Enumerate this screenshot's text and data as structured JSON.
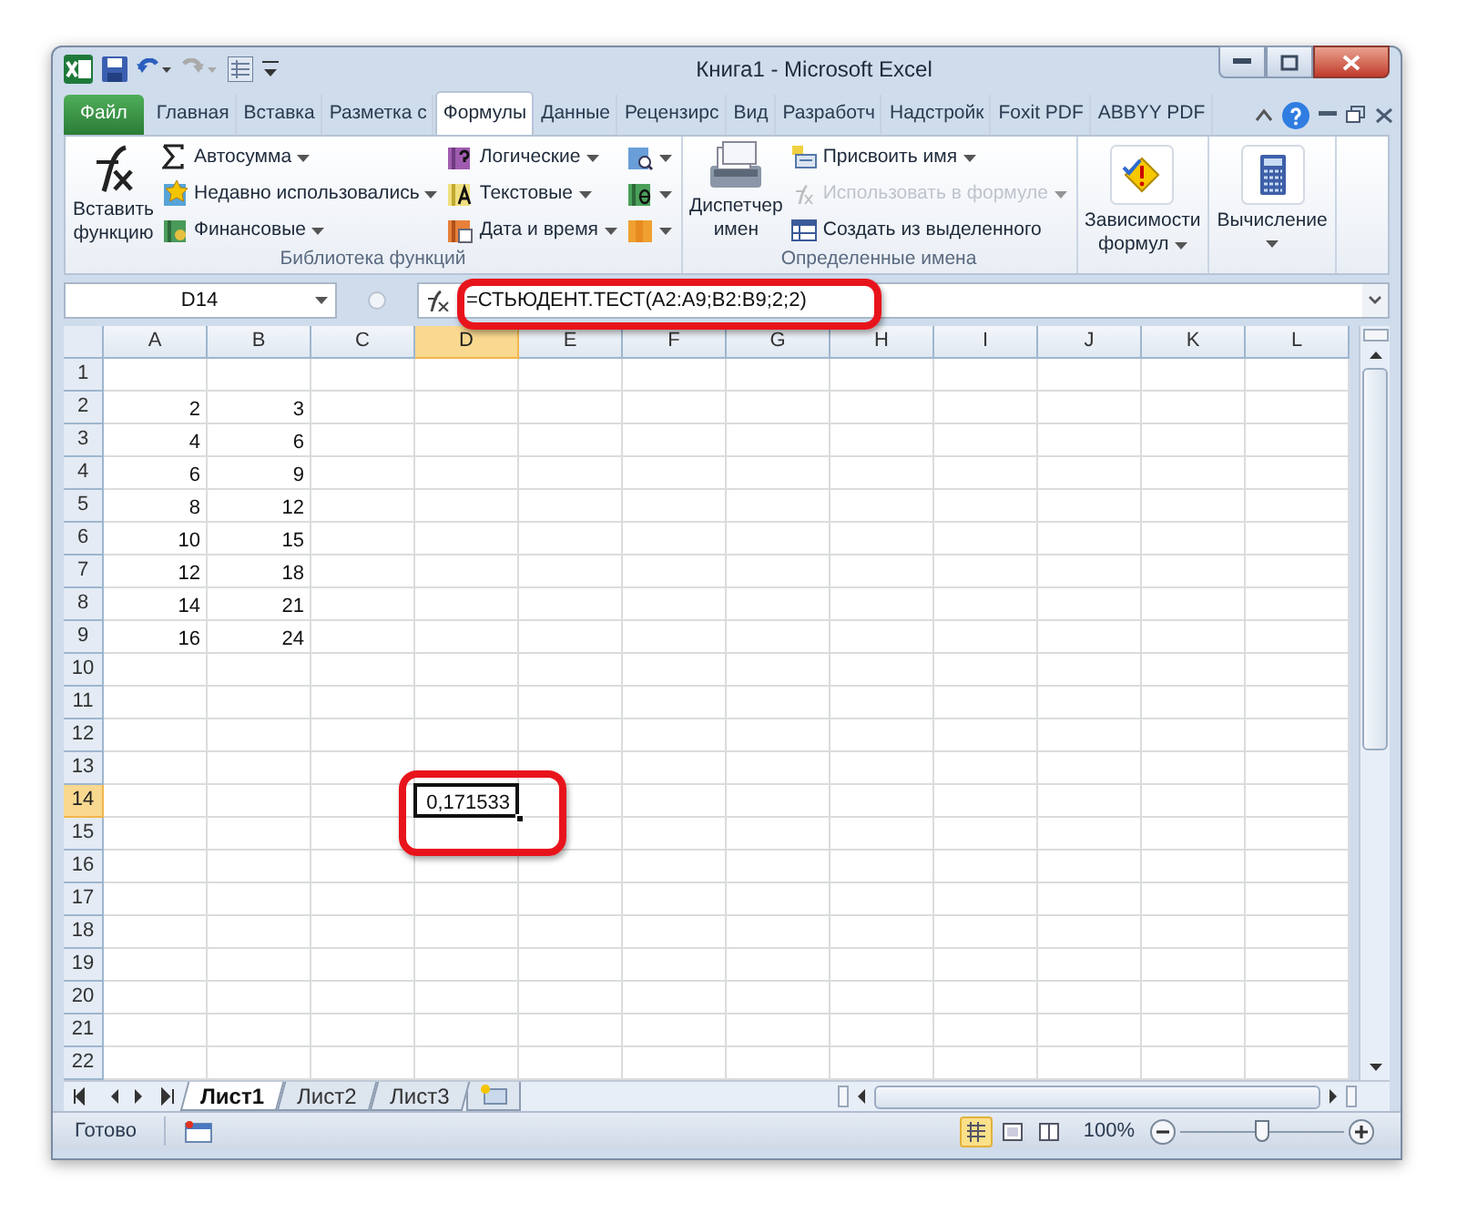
{
  "window": {
    "title": "Книга1 - Microsoft Excel"
  },
  "ribbon_tabs": [
    {
      "label": "Файл",
      "kind": "file",
      "selected": false
    },
    {
      "label": "Главная",
      "kind": "tab",
      "selected": false
    },
    {
      "label": "Вставка",
      "kind": "tab",
      "selected": false
    },
    {
      "label": "Разметка с",
      "kind": "tab",
      "selected": false
    },
    {
      "label": "Формулы",
      "kind": "tab",
      "selected": true
    },
    {
      "label": "Данные",
      "kind": "tab",
      "selected": false
    },
    {
      "label": "Рецензирс",
      "kind": "tab",
      "selected": false
    },
    {
      "label": "Вид",
      "kind": "tab",
      "selected": false
    },
    {
      "label": "Разработч",
      "kind": "tab",
      "selected": false
    },
    {
      "label": "Надстройк",
      "kind": "tab",
      "selected": false
    },
    {
      "label": "Foxit PDF",
      "kind": "tab",
      "selected": false
    },
    {
      "label": "ABBYY PDF",
      "kind": "tab",
      "selected": false
    }
  ],
  "ribbon_groups": [
    {
      "title": "Библиотека функций",
      "big_button": {
        "lines": [
          "Вставить",
          "функцию"
        ],
        "dropdown": false
      },
      "columns": [
        [
          {
            "label": "Автосумма",
            "dropdown": true,
            "disabled": false
          },
          {
            "label": "Недавно использовались",
            "dropdown": true,
            "disabled": false
          },
          {
            "label": "Финансовые",
            "dropdown": true,
            "disabled": false
          }
        ],
        [
          {
            "label": "Логические",
            "dropdown": true,
            "disabled": false
          },
          {
            "label": "Текстовые",
            "dropdown": true,
            "disabled": false
          },
          {
            "label": "Дата и время",
            "dropdown": true,
            "disabled": false
          }
        ],
        [
          {
            "dropdown": true,
            "disabled": false
          },
          {
            "dropdown": true,
            "disabled": false
          },
          {
            "dropdown": true,
            "disabled": false
          }
        ]
      ]
    },
    {
      "title": "Определенные имена",
      "big_button": {
        "lines": [
          "Диспетчер",
          "имен"
        ],
        "dropdown": false
      },
      "columns": [
        [
          {
            "label": "Присвоить имя",
            "dropdown": true,
            "disabled": false
          },
          {
            "label": "Использовать в формуле",
            "dropdown": true,
            "disabled": true
          },
          {
            "label": "Создать из выделенного",
            "dropdown": false,
            "disabled": false
          }
        ]
      ]
    },
    {
      "big_button": {
        "lines": [
          "Зависимости",
          "формул"
        ],
        "dropdown": true
      }
    },
    {
      "big_button": {
        "lines": [
          "Вычисление"
        ],
        "dropdown": true
      }
    }
  ],
  "formula_bar": {
    "name_box": "D14",
    "formula": "=СТЬЮДЕНТ.ТЕСТ(A2:A9;B2:B9;2;2)",
    "annotated": true
  },
  "sheet": {
    "columns": [
      {
        "label": "A",
        "selected": false
      },
      {
        "label": "B",
        "selected": false
      },
      {
        "label": "C",
        "selected": false
      },
      {
        "label": "D",
        "selected": true
      },
      {
        "label": "E",
        "selected": false
      },
      {
        "label": "F",
        "selected": false
      },
      {
        "label": "G",
        "selected": false
      },
      {
        "label": "H",
        "selected": false
      },
      {
        "label": "I",
        "selected": false
      },
      {
        "label": "J",
        "selected": false
      },
      {
        "label": "K",
        "selected": false
      },
      {
        "label": "L",
        "selected": false
      }
    ],
    "rows": [
      {
        "label": "1",
        "selected": false
      },
      {
        "label": "2",
        "selected": false,
        "cells": [
          {
            "value": "2",
            "selected": false
          },
          {
            "value": "3",
            "selected": false
          }
        ]
      },
      {
        "label": "3",
        "selected": false,
        "cells": [
          {
            "value": "4",
            "selected": false
          },
          {
            "value": "6",
            "selected": false
          }
        ]
      },
      {
        "label": "4",
        "selected": false,
        "cells": [
          {
            "value": "6",
            "selected": false
          },
          {
            "value": "9",
            "selected": false
          }
        ]
      },
      {
        "label": "5",
        "selected": false,
        "cells": [
          {
            "value": "8",
            "selected": false
          },
          {
            "value": "12",
            "selected": false
          }
        ]
      },
      {
        "label": "6",
        "selected": false,
        "cells": [
          {
            "value": "10",
            "selected": false
          },
          {
            "value": "15",
            "selected": false
          }
        ]
      },
      {
        "label": "7",
        "selected": false,
        "cells": [
          {
            "value": "12",
            "selected": false
          },
          {
            "value": "18",
            "selected": false
          }
        ]
      },
      {
        "label": "8",
        "selected": false,
        "cells": [
          {
            "value": "14",
            "selected": false
          },
          {
            "value": "21",
            "selected": false
          }
        ]
      },
      {
        "label": "9",
        "selected": false,
        "cells": [
          {
            "value": "16",
            "selected": false
          },
          {
            "value": "24",
            "selected": false
          }
        ]
      },
      {
        "label": "10",
        "selected": false
      },
      {
        "label": "11",
        "selected": false
      },
      {
        "label": "12",
        "selected": false
      },
      {
        "label": "13",
        "selected": false
      },
      {
        "label": "14",
        "selected": true,
        "cells": [
          null,
          null,
          null,
          {
            "value": "0,171533",
            "selected": true,
            "annotated": true
          }
        ]
      },
      {
        "label": "15",
        "selected": false
      },
      {
        "label": "16",
        "selected": false
      },
      {
        "label": "17",
        "selected": false
      },
      {
        "label": "18",
        "selected": false
      },
      {
        "label": "19",
        "selected": false
      },
      {
        "label": "20",
        "selected": false
      },
      {
        "label": "21",
        "selected": false
      },
      {
        "label": "22",
        "selected": false
      }
    ]
  },
  "sheet_tabs": [
    {
      "label": "Лист1",
      "selected": true
    },
    {
      "label": "Лист2",
      "selected": false
    },
    {
      "label": "Лист3",
      "selected": false
    }
  ],
  "status_bar": {
    "status": "Готово",
    "views": [
      {
        "kind": "normal",
        "selected": true
      },
      {
        "kind": "layout",
        "selected": false
      },
      {
        "kind": "pagebreak",
        "selected": false
      }
    ],
    "zoom": "100%",
    "level": 0.5
  }
}
